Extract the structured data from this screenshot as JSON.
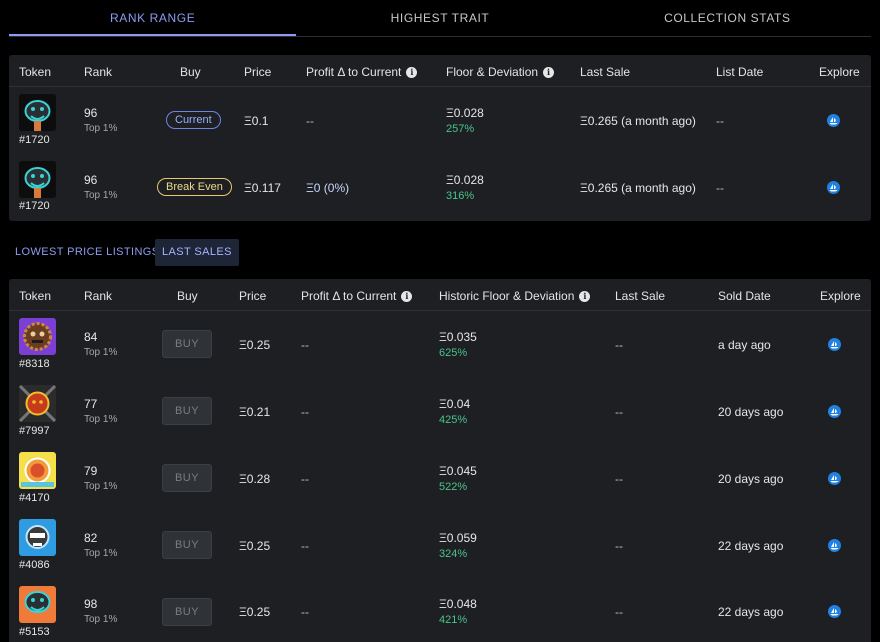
{
  "tabs": {
    "rank_range": "RANK RANGE",
    "highest_trait": "HIGHEST TRAIT",
    "collection_stats": "COLLECTION STATS"
  },
  "top_table": {
    "headers": {
      "token": "Token",
      "rank": "Rank",
      "buy": "Buy",
      "price": "Price",
      "profit": "Profit Δ to Current",
      "floor": "Floor & Deviation",
      "last_sale": "Last Sale",
      "list_date": "List Date",
      "explore": "Explore"
    },
    "rows": [
      {
        "token_id": "#1720",
        "rank": "96",
        "rank_sub": "Top 1%",
        "buy_label": "Current",
        "price": "Ξ0.1",
        "profit": "--",
        "floor": "Ξ0.028",
        "deviation": "257%",
        "last_sale": "Ξ0.265 (a month ago)",
        "list_date": "--"
      },
      {
        "token_id": "#1720",
        "rank": "96",
        "rank_sub": "Top 1%",
        "buy_label": "Break Even",
        "price": "Ξ0.117",
        "profit": "Ξ0 (0%)",
        "floor": "Ξ0.028",
        "deviation": "316%",
        "last_sale": "Ξ0.265 (a month ago)",
        "list_date": "--"
      }
    ]
  },
  "sub_tabs": {
    "lowest_price_listings": "LOWEST PRICE LISTINGS",
    "last_sales": "LAST SALES"
  },
  "bottom_table": {
    "headers": {
      "token": "Token",
      "rank": "Rank",
      "buy": "Buy",
      "price": "Price",
      "profit": "Profit Δ to Current",
      "floor": "Historic Floor & Deviation",
      "last_sale": "Last Sale",
      "sold_date": "Sold Date",
      "explore": "Explore"
    },
    "buy_label": "BUY",
    "rows": [
      {
        "token_id": "#8318",
        "rank": "84",
        "rank_sub": "Top 1%",
        "price": "Ξ0.25",
        "profit": "--",
        "floor": "Ξ0.035",
        "deviation": "625%",
        "last_sale": "--",
        "sold_date": "a day ago"
      },
      {
        "token_id": "#7997",
        "rank": "77",
        "rank_sub": "Top 1%",
        "price": "Ξ0.21",
        "profit": "--",
        "floor": "Ξ0.04",
        "deviation": "425%",
        "last_sale": "--",
        "sold_date": "20 days ago"
      },
      {
        "token_id": "#4170",
        "rank": "79",
        "rank_sub": "Top 1%",
        "price": "Ξ0.28",
        "profit": "--",
        "floor": "Ξ0.045",
        "deviation": "522%",
        "last_sale": "--",
        "sold_date": "20 days ago"
      },
      {
        "token_id": "#4086",
        "rank": "82",
        "rank_sub": "Top 1%",
        "price": "Ξ0.25",
        "profit": "--",
        "floor": "Ξ0.059",
        "deviation": "324%",
        "last_sale": "--",
        "sold_date": "22 days ago"
      },
      {
        "token_id": "#5153",
        "rank": "98",
        "rank_sub": "Top 1%",
        "price": "Ξ0.25",
        "profit": "--",
        "floor": "Ξ0.048",
        "deviation": "421%",
        "last_sale": "--",
        "sold_date": "22 days ago"
      }
    ]
  },
  "icons": {
    "info": "info-icon",
    "explore": "opensea-icon"
  },
  "colors": {
    "accent": "#8c9cf0",
    "positive": "#4cc38a",
    "opensea_blue": "#2081e2",
    "panel_bg": "#1d1f23"
  }
}
